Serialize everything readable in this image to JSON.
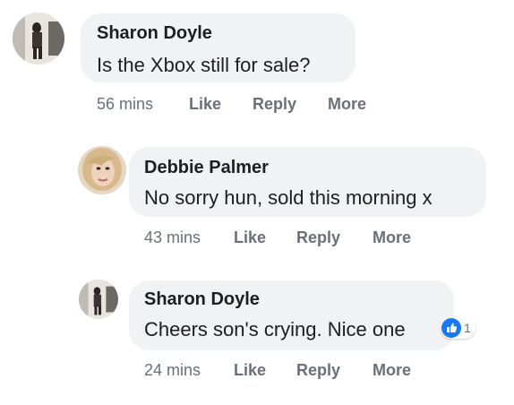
{
  "comments": [
    {
      "author": "Sharon Doyle",
      "text": "Is the Xbox still for sale?",
      "time": "56 mins",
      "like_label": "Like",
      "reply_label": "Reply",
      "more_label": "More"
    },
    {
      "author": "Debbie Palmer",
      "text": "No sorry hun, sold this morning x",
      "time": "43 mins",
      "like_label": "Like",
      "reply_label": "Reply",
      "more_label": "More"
    },
    {
      "author": "Sharon Doyle",
      "text": "Cheers son's crying. Nice one",
      "time": "24 mins",
      "like_label": "Like",
      "reply_label": "Reply",
      "more_label": "More",
      "reaction": {
        "icon": "thumbs-up-icon",
        "count": "1",
        "color": "#1877f2"
      }
    }
  ],
  "colors": {
    "bubble": "#f1f2f4",
    "meta": "#6a6f78",
    "text": "#1c1e21"
  }
}
